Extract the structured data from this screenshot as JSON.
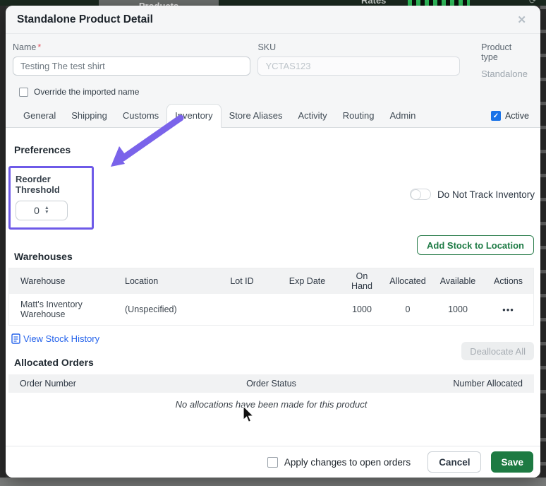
{
  "background": {
    "products_tab_label": "Products",
    "rates_label": "Rates"
  },
  "modal": {
    "title": "Standalone Product Detail",
    "close_icon": "✕",
    "fields": {
      "name_label": "Name",
      "required_mark": "*",
      "name_value": "Testing The test shirt",
      "sku_label": "SKU",
      "sku_placeholder": "YCTAS123",
      "product_type_label": "Product type",
      "product_type_value": "Standalone"
    },
    "override_checkbox_label": "Override the imported name",
    "tabs": [
      "General",
      "Shipping",
      "Customs",
      "Inventory",
      "Store Aliases",
      "Activity",
      "Routing",
      "Admin"
    ],
    "active_tab": "Inventory",
    "active_checkbox_label": "Active",
    "check_glyph": "✓",
    "inventory": {
      "preferences_heading": "Preferences",
      "reorder_threshold_label": "Reorder Threshold",
      "reorder_threshold_value": "0",
      "spinner_up_icon": "▲",
      "spinner_down_icon": "▼",
      "do_not_track_label": "Do Not Track Inventory",
      "warehouses_heading": "Warehouses",
      "add_stock_button": "Add Stock to Location",
      "warehouse_table": {
        "headers": [
          "Warehouse",
          "Location",
          "Lot ID",
          "Exp Date",
          "On Hand",
          "Allocated",
          "Available",
          "Actions"
        ],
        "rows": [
          {
            "warehouse": "Matt's Inventory Warehouse",
            "location": "(Unspecified)",
            "lot_id": "",
            "exp_date": "",
            "on_hand": "1000",
            "allocated": "0",
            "available": "1000",
            "actions_icon": "•••"
          }
        ]
      },
      "view_stock_history_link": "View Stock History",
      "allocated_orders_heading": "Allocated Orders",
      "deallocate_all_button": "Deallocate All",
      "orders_table": {
        "headers": [
          "Order Number",
          "Order Status",
          "Number Allocated"
        ],
        "empty_message": "No allocations have been made for this product"
      }
    },
    "footer": {
      "apply_checkbox_label": "Apply changes to open orders",
      "cancel_button": "Cancel",
      "save_button": "Save"
    }
  },
  "colors": {
    "accent_green": "#1d7a42",
    "link_blue": "#2563eb",
    "highlight_purple": "#6e5ae8",
    "checkbox_blue": "#1a73e8"
  }
}
